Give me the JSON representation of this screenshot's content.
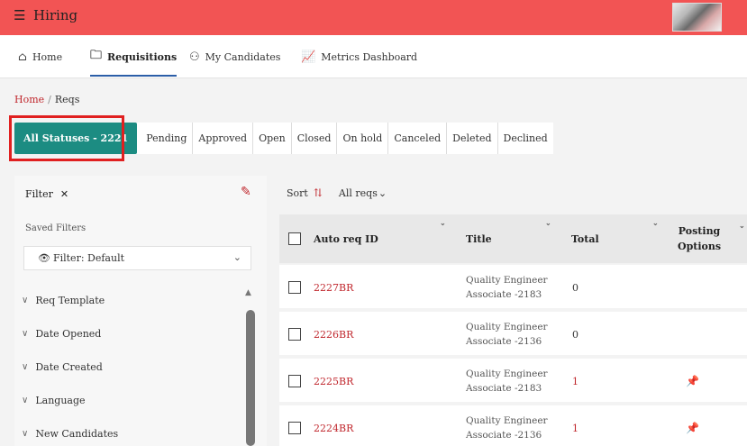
{
  "topbar": {
    "menu_icon": "hamburger-icon",
    "title": "Hiring"
  },
  "nav": {
    "items": [
      {
        "icon": "home-icon",
        "label": "Home"
      },
      {
        "icon": "folder-icon",
        "label": "Requisitions"
      },
      {
        "icon": "people-icon",
        "label": "My Candidates"
      },
      {
        "icon": "chart-icon",
        "label": "Metrics Dashboard"
      }
    ],
    "active": "Requisitions"
  },
  "breadcrumb": {
    "home": "Home",
    "sep": "/",
    "current": "Reqs"
  },
  "status_tabs": [
    "All Statuses - 2221",
    "Pending",
    "Approved",
    "Open",
    "Closed",
    "On hold",
    "Canceled",
    "Deleted",
    "Declined"
  ],
  "filter": {
    "title": "Filter",
    "close": "✕",
    "saved_label": "Saved Filters",
    "selected": "Filter: Default",
    "groups": [
      "Req Template",
      "Date Opened",
      "Date Created",
      "Language",
      "New Candidates"
    ]
  },
  "sortbar": {
    "sort_label": "Sort",
    "view": "All reqs"
  },
  "table": {
    "headers": {
      "id": "Auto req ID",
      "title": "Title",
      "total": "Total",
      "posting1": "Posting",
      "posting2": "Options"
    },
    "rows": [
      {
        "id": "2227BR",
        "title1": "Quality Engineer",
        "title2": "Associate -2183",
        "total": "0",
        "pinned": false
      },
      {
        "id": "2226BR",
        "title1": "Quality Engineer",
        "title2": "Associate -2136",
        "total": "0",
        "pinned": false
      },
      {
        "id": "2225BR",
        "title1": "Quality Engineer",
        "title2": "Associate -2183",
        "total": "1",
        "pinned": true
      },
      {
        "id": "2224BR",
        "title1": "Quality Engineer",
        "title2": "Associate -2136",
        "total": "1",
        "pinned": true
      }
    ]
  },
  "colors": {
    "topbar": "#f25454",
    "accent": "#1c8c82",
    "link": "#c0272d",
    "highlight": "#e02020"
  }
}
